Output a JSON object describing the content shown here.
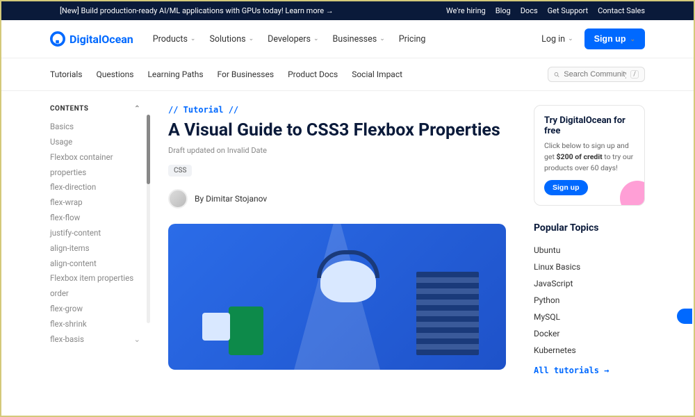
{
  "announcement": {
    "text": "[New] Build production-ready AI/ML applications with GPUs today! Learn more →",
    "links": [
      "We're hiring",
      "Blog",
      "Docs",
      "Get Support",
      "Contact Sales"
    ]
  },
  "brand": "DigitalOcean",
  "nav": {
    "items": [
      "Products",
      "Solutions",
      "Developers",
      "Businesses",
      "Pricing"
    ],
    "login": "Log in",
    "signup": "Sign up"
  },
  "subnav": {
    "tabs": [
      "Tutorials",
      "Questions",
      "Learning Paths",
      "For Businesses",
      "Product Docs",
      "Social Impact"
    ],
    "search_placeholder": "Search Community",
    "kbd": "/"
  },
  "toc": {
    "heading": "CONTENTS",
    "items": [
      "Basics",
      "Usage",
      "Flexbox container properties",
      "flex-direction",
      "flex-wrap",
      "flex-flow",
      "justify-content",
      "align-items",
      "align-content",
      "Flexbox item properties",
      "order",
      "flex-grow",
      "flex-shrink",
      "flex-basis"
    ]
  },
  "article": {
    "breadcrumb": "// Tutorial //",
    "title": "A Visual Guide to CSS3 Flexbox Properties",
    "meta": "Draft updated on Invalid Date",
    "tag": "CSS",
    "byline": "By Dimitar Stojanov"
  },
  "promo": {
    "title": "Try DigitalOcean for free",
    "body_pre": "Click below to sign up and get ",
    "body_bold": "$200 of credit",
    "body_post": " to try our products over 60 days!",
    "cta": "Sign up"
  },
  "popular": {
    "heading": "Popular Topics",
    "items": [
      "Ubuntu",
      "Linux Basics",
      "JavaScript",
      "Python",
      "MySQL",
      "Docker",
      "Kubernetes"
    ],
    "all": "All tutorials →"
  }
}
